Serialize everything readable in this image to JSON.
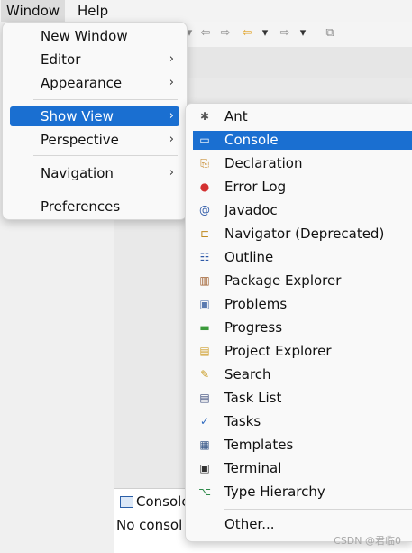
{
  "menubar": {
    "window": "Window",
    "help": "Help"
  },
  "toolbar": {
    "icons": [
      "chevron-down-icon",
      "back-outline-icon",
      "forward-outline-icon",
      "back-arrow-icon",
      "chevron-down-icon",
      "forward-arrow-icon",
      "chevron-down-icon",
      "pin-editor-icon"
    ]
  },
  "window_menu": {
    "new_window": "New Window",
    "editor": "Editor",
    "appearance": "Appearance",
    "show_view": "Show View",
    "perspective": "Perspective",
    "navigation": "Navigation",
    "preferences": "Preferences",
    "arrow": "›"
  },
  "show_view_menu": {
    "items": [
      {
        "label": "Ant",
        "icon": "ant-icon",
        "glyph": "✱",
        "color": "#555555"
      },
      {
        "label": "Console",
        "icon": "console-icon",
        "glyph": "▭",
        "color": "#ffffff"
      },
      {
        "label": "Declaration",
        "icon": "declaration-icon",
        "glyph": "⎘",
        "color": "#c07a10"
      },
      {
        "label": "Error Log",
        "icon": "error-log-icon",
        "glyph": "●",
        "color": "#d33030"
      },
      {
        "label": "Javadoc",
        "icon": "javadoc-icon",
        "glyph": "@",
        "color": "#2f5aa8"
      },
      {
        "label": "Navigator (Deprecated)",
        "icon": "navigator-icon",
        "glyph": "⊏",
        "color": "#c08a20"
      },
      {
        "label": "Outline",
        "icon": "outline-icon",
        "glyph": "☷",
        "color": "#2f5aa8"
      },
      {
        "label": "Package Explorer",
        "icon": "package-explorer-icon",
        "glyph": "▥",
        "color": "#a06030"
      },
      {
        "label": "Problems",
        "icon": "problems-icon",
        "glyph": "▣",
        "color": "#5a7ab0"
      },
      {
        "label": "Progress",
        "icon": "progress-icon",
        "glyph": "▬",
        "color": "#3a9a3a"
      },
      {
        "label": "Project Explorer",
        "icon": "project-explorer-icon",
        "glyph": "▤",
        "color": "#d0a030"
      },
      {
        "label": "Search",
        "icon": "search-icon",
        "glyph": "✎",
        "color": "#c89a20"
      },
      {
        "label": "Task List",
        "icon": "task-list-icon",
        "glyph": "▤",
        "color": "#3a4a7a"
      },
      {
        "label": "Tasks",
        "icon": "tasks-icon",
        "glyph": "✓",
        "color": "#2f6ac0"
      },
      {
        "label": "Templates",
        "icon": "templates-icon",
        "glyph": "▦",
        "color": "#3a5a8a"
      },
      {
        "label": "Terminal",
        "icon": "terminal-icon",
        "glyph": "▣",
        "color": "#333333"
      },
      {
        "label": "Type Hierarchy",
        "icon": "type-hierarchy-icon",
        "glyph": "⌥",
        "color": "#2e8a4a"
      }
    ],
    "other": "Other..."
  },
  "console_panel": {
    "tab_label": "Console",
    "body_text": "No consol"
  },
  "watermark": "CSDN @君临0",
  "colors": {
    "accent": "#1a6fd1"
  }
}
